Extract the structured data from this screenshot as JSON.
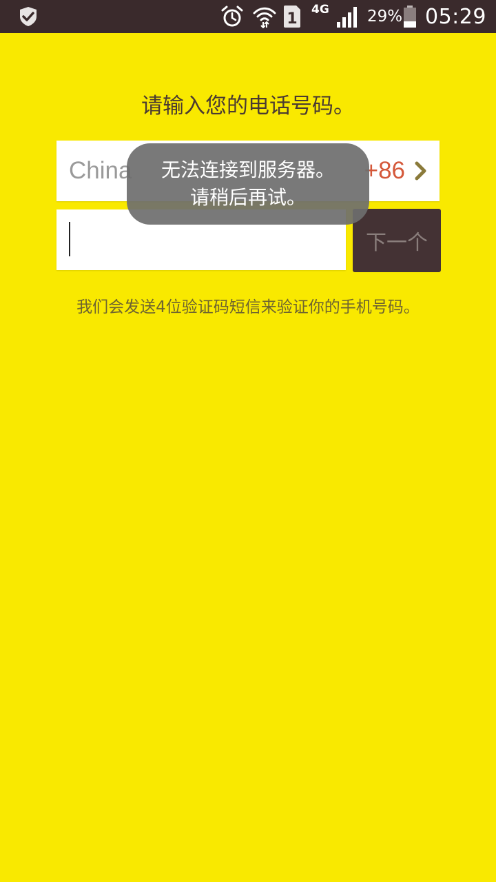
{
  "status_bar": {
    "network": "4G",
    "sim_slot": "1",
    "battery_percent": "29%",
    "time": "05:29",
    "icons": [
      "shield-check-icon",
      "alarm-icon",
      "wifi-icon",
      "sim-icon",
      "signal-icon",
      "battery-icon"
    ]
  },
  "page": {
    "title": "请输入您的电话号码。",
    "country": {
      "name": "China",
      "code": "+86"
    },
    "phone_input": {
      "value": "",
      "placeholder": ""
    },
    "next_label": "下一个",
    "hint": "我们会发送4位验证码短信来验证你的手机号码。"
  },
  "toast": {
    "line1": "无法连接到服务器。",
    "line2": "请稍后再试。"
  },
  "colors": {
    "background": "#f9e900",
    "status_bar": "#3a2a2c",
    "next_button": "#443234",
    "country_code": "#d4583a",
    "chevron": "#8a7a3a",
    "toast": "#6e6e6e"
  }
}
